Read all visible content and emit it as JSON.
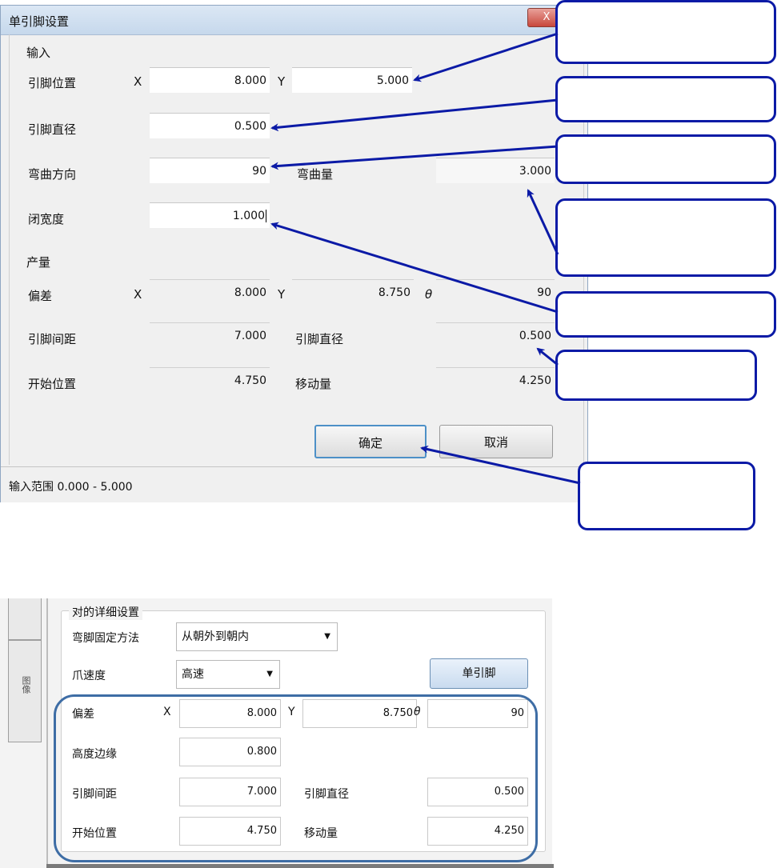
{
  "dialog": {
    "title": "单引脚设置",
    "close_label": "X",
    "input_section": "输入",
    "pin_position_label": "引脚位置",
    "x_label": "X",
    "y_label": "Y",
    "pin_pos_x": "8.000",
    "pin_pos_y": "5.000",
    "pin_diameter_label": "引脚直径",
    "pin_diameter": "0.500",
    "bend_direction_label": "弯曲方向",
    "bend_direction": "90",
    "bend_amount_label": "弯曲量",
    "bend_amount": "3.000",
    "close_width_label": "闭宽度",
    "close_width": "1.000",
    "output_section": "产量",
    "offset_label": "偏差",
    "offset_x": "8.000",
    "offset_y": "8.750",
    "theta_label": "θ",
    "offset_theta": "90",
    "pin_spacing_label": "引脚间距",
    "pin_spacing": "7.000",
    "out_pin_diameter_label": "引脚直径",
    "out_pin_diameter": "0.500",
    "start_position_label": "开始位置",
    "start_position": "4.750",
    "move_amount_label": "移动量",
    "move_amount": "4.250",
    "ok_label": "确定",
    "cancel_label": "取消",
    "status": "输入范围 0.000 - 5.000"
  },
  "panel": {
    "group_title": "对的详细设置",
    "bend_fix_label": "弯脚固定方法",
    "bend_fix_value": "从朝外到朝内",
    "claw_speed_label": "爪速度",
    "claw_speed_value": "高速",
    "single_pin_button": "单引脚",
    "side_tab": "图像",
    "offset_label": "偏差",
    "x_label": "X",
    "y_label": "Y",
    "theta_label": "θ",
    "offset_x": "8.000",
    "offset_y": "8.750",
    "offset_theta": "90",
    "height_margin_label": "高度边缘",
    "height_margin": "0.800",
    "pin_spacing_label": "引脚间距",
    "pin_spacing": "7.000",
    "pin_diameter_label": "引脚直径",
    "pin_diameter": "0.500",
    "start_position_label": "开始位置",
    "start_position": "4.750",
    "move_amount_label": "移动量",
    "move_amount": "4.250"
  },
  "colors": {
    "callout_border": "#0b1aa6",
    "arrow": "#0b1aa6",
    "highlight_border": "#3e6da5"
  }
}
